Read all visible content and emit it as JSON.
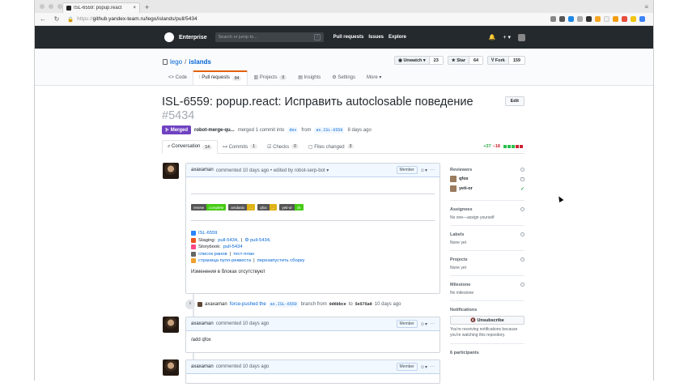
{
  "browser": {
    "tab_title": "ISL-6559: popup.react",
    "url_scheme": "https://",
    "url_rest": "github.yandex-team.ru/lego/islands/pull/5434"
  },
  "header": {
    "brand": "Enterprise",
    "search_placeholder": "Search or jump to...",
    "search_key": "/",
    "nav": [
      "Pull requests",
      "Issues",
      "Explore"
    ],
    "plus": "+ ▾"
  },
  "repo": {
    "owner": "lego",
    "name": "islands",
    "unwatch_label": "◉ Unwatch ▾",
    "unwatch_count": "23",
    "star_label": "★ Star",
    "star_count": "64",
    "fork_label": "Ⴤ Fork",
    "fork_count": "159",
    "tabs": [
      {
        "label": "<> Code",
        "count": ""
      },
      {
        "label": "⫶ Pull requests",
        "count": "84"
      },
      {
        "label": "▥ Projects",
        "count": "0"
      },
      {
        "label": "▤ Insights",
        "count": ""
      },
      {
        "label": "⚙ Settings",
        "count": ""
      },
      {
        "label": "More ▾",
        "count": ""
      }
    ]
  },
  "pr": {
    "title": "ISL-6559: popup.react: Исправить autoclosable поведение",
    "number": "#5434",
    "edit_label": "Edit",
    "status": "⊱ Merged",
    "author": "robot-merge-qu...",
    "merged_text": "merged 1 commit into",
    "base": "dev",
    "from": "from",
    "head": "ax.ISL-6559",
    "ago": "8 days ago",
    "tabs": [
      {
        "label": "⌕ Conversation",
        "count": "14"
      },
      {
        "label": "⊶ Commits",
        "count": "1"
      },
      {
        "label": "☑ Checks",
        "count": "0"
      },
      {
        "label": "▢ Files changed",
        "count": "3"
      }
    ],
    "additions": "+37",
    "deletions": "−18"
  },
  "comments": [
    {
      "author": "axaxaman",
      "meta": "commented 10 days ago • edited by robot-serp-bot ▾",
      "role": "Member",
      "badges": [
        {
          "l": "review",
          "r": "complete",
          "color": "#4c1"
        },
        {
          "l": "amdanix",
          "r": "...",
          "color": "#dfb317"
        },
        {
          "l": "qfox",
          "r": "...",
          "color": "#dfb317"
        },
        {
          "l": "yeti-or",
          "r": "ok",
          "color": "#4c1"
        }
      ],
      "issue": "ISL-6559",
      "staging_label": "Staging:",
      "staging_link1": "pull-5434,",
      "staging_link2": "⚙ pull-5434,",
      "storybook_label": "Storybook:",
      "storybook_link": "pull-5434",
      "runs": "список ранов",
      "testplan": "тест-план",
      "pr_page": "страница пулл-реквеста",
      "rebuild": "перезапустить сборку",
      "sep": "|",
      "text": "Изменения в блоках отсутствуют"
    },
    {
      "author": "axaxaman",
      "meta": "commented 10 days ago",
      "role": "Member",
      "text": "/add qfox"
    },
    {
      "author": "axaxaman",
      "meta": "commented 10 days ago",
      "role": "Member"
    }
  ],
  "event": {
    "author": "axaxaman",
    "action": "force-pushed the",
    "branch": "ax.ISL-6559",
    "mid": "branch from",
    "from_sha": "0d6bbce",
    "to": "to",
    "to_sha": "5e575a8",
    "ago": "10 days ago"
  },
  "sidebar": {
    "reviewers_title": "Reviewers",
    "reviewers": [
      {
        "name": "qfox",
        "state": "◻"
      },
      {
        "name": "yeti-or",
        "state": "✓"
      }
    ],
    "assignees_title": "Assignees",
    "assignees_value": "No one—assign yourself",
    "labels_title": "Labels",
    "labels_value": "None yet",
    "projects_title": "Projects",
    "projects_value": "None yet",
    "milestone_title": "Milestone",
    "milestone_value": "No milestone",
    "notifications_title": "Notifications",
    "unsubscribe_label": "🔇 Unsubscribe",
    "notif_text": "You're receiving notifications because you're watching this repository.",
    "participants": "6 participants"
  }
}
